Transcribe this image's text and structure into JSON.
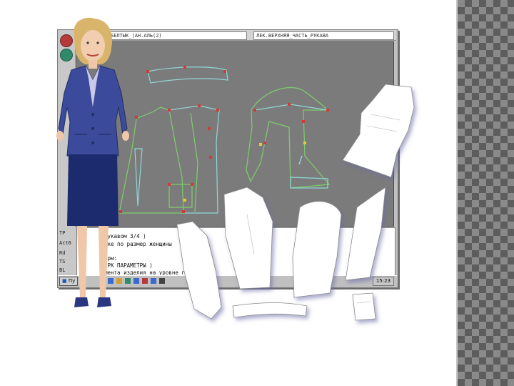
{
  "window": {
    "title_left": "БЕЛТЫК_(АН.АЛЬ(2)",
    "title_right": "ЛЕК.ВЕРХНЯЯ_ЧАСТЬ_РУКАВА"
  },
  "command_panel": {
    "labels": [
      "TP",
      "Act6",
      "Rd",
      "TS",
      "BL"
    ],
    "lines": [
      "рукавом 3/4 )",
      "тке по размер женщины",
      "",
      "ерм:",
      "ЕРК ПАРАМЕТРЫ )",
      "мента изделия на уровне груди )"
    ]
  },
  "taskbar": {
    "start_label": "Пу",
    "clock": "15:23"
  },
  "colors": {
    "canvas": "#7b7b7b",
    "pattern_line_green": "#7cd06a",
    "pattern_line_cyan": "#8fd8d8",
    "marker_red": "#d23a3a",
    "jacket_blue": "#3b4a9a",
    "skirt_navy": "#1c2a6e",
    "checker_dark": "#5d5d5d",
    "checker_light": "#8a8a8a"
  },
  "icons": [
    "red-circle-tool-icon",
    "green-circle-tool-icon",
    "windows-start-icon",
    "clock-icon"
  ]
}
